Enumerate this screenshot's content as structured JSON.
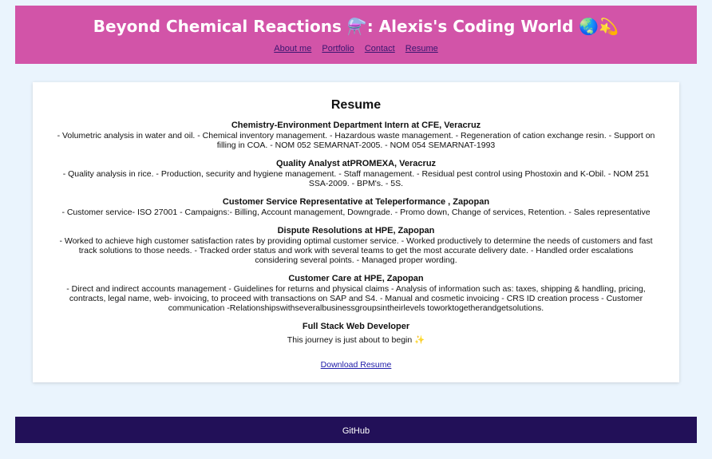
{
  "header": {
    "title": "Beyond Chemical Reactions ⚗️: Alexis's Coding World 🌏💫",
    "nav": [
      "About me",
      "Portfolio",
      "Contact",
      "Resume"
    ]
  },
  "resume": {
    "heading": "Resume",
    "jobs": [
      {
        "title": "Chemistry-Environment Department Intern at CFE, Veracruz",
        "desc": "- Volumetric analysis in water and oil. - Chemical inventory management. - Hazardous waste management. - Regeneration of cation exchange resin. - Support on filling in COA. - NOM 052 SEMARNAT-2005. - NOM 054 SEMARNAT-1993"
      },
      {
        "title": "Quality Analyst atPROMEXA, Veracruz",
        "desc": "- Quality analysis in rice. - Production, security and hygiene management. - Staff management. - Residual pest control using Phostoxin and K-Obil. - NOM 251 SSA-2009. - BPM's. - 5S."
      },
      {
        "title": "Customer Service Representative at Teleperformance , Zapopan",
        "desc": "- Customer service- ISO 27001 - Campaigns:- Billing, Account management, Downgrade. - Promo down, Change of services, Retention. - Sales representative"
      },
      {
        "title": "Dispute Resolutions at HPE, Zapopan",
        "desc": "- Worked to achieve high customer satisfaction rates by providing optimal customer service. - Worked productively to determine the needs of customers and fast track solutions to those needs. - Tracked order status and work with several teams to get the most accurate delivery date. - Handled order escalations considering several points. - Managed proper wording."
      },
      {
        "title": "Customer Care at HPE, Zapopan",
        "desc": "- Direct and indirect accounts management - Guidelines for returns and physical claims - Analysis of information such as: taxes, shipping & handling, pricing, contracts, legal name, web- invoicing, to proceed with transactions on SAP and S4. - Manual and cosmetic invoicing - CRS ID creation process - Customer communication -Relationshipswithseveralbusinessgroupsintheirlevels toworktogetherandgetsolutions."
      }
    ],
    "current": {
      "title": "Full Stack Web Developer",
      "desc": "This journey is just about to begin ✨"
    },
    "download_label": "Download Resume"
  },
  "footer": {
    "link": "GitHub"
  }
}
